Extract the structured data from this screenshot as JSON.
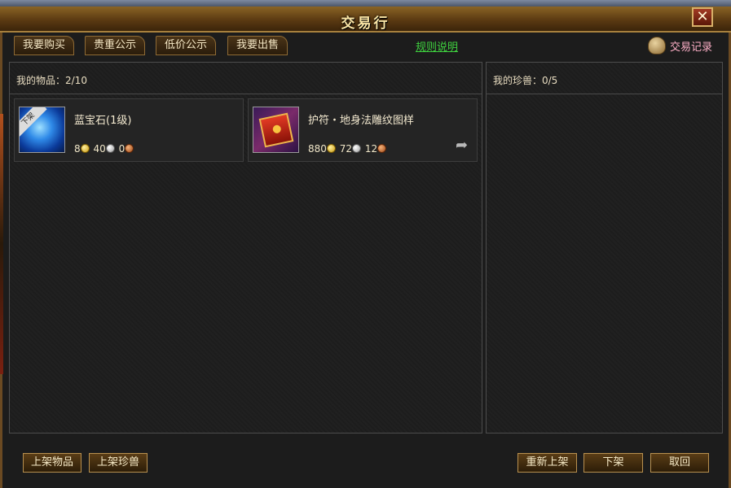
{
  "window": {
    "title": "交易行",
    "close": "✕"
  },
  "tabs": [
    {
      "label": "我要购买"
    },
    {
      "label": "贵重公示"
    },
    {
      "label": "低价公示"
    },
    {
      "label": "我要出售"
    }
  ],
  "rules_link": "规则说明",
  "record_link": "交易记录",
  "left_panel": {
    "label": "我的物品：2/10"
  },
  "right_panel": {
    "label": "我的珍兽：0/5"
  },
  "items": [
    {
      "name": "蓝宝石(1级)",
      "icon": "sapphire-gem-icon",
      "badge": "下架",
      "price": {
        "gold": "8",
        "silver": "40",
        "copper": "0"
      }
    },
    {
      "name": "护符・地身法雕纹图样",
      "icon": "talisman-scroll-icon",
      "price": {
        "gold": "880",
        "silver": "72",
        "copper": "12"
      },
      "action_icon": "share-arrow-icon"
    }
  ],
  "buttons": {
    "list_item": "上架物品",
    "list_pet": "上架珍兽",
    "relist": "重新上架",
    "delist": "下架",
    "retrieve": "取回"
  },
  "colors": {
    "rules_link": "#3fd23f",
    "record_link": "#ffb0c8",
    "title": "#fbe6a6"
  }
}
